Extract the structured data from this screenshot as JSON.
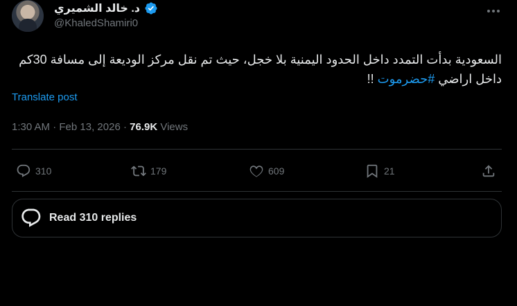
{
  "tweet": {
    "author_name": "د. خالد الشميري",
    "author_handle": "@KhaledShamiri0",
    "text_before_hashtag": "السعودية بدأت التمدد داخل الحدود اليمنية بلا خجل، حيث تم نقل مركز الوديعة إلى مسافة 30كم داخل اراضي ",
    "hashtag": "#حضرموت",
    "text_after_hashtag": " !!",
    "translate_label": "Translate post",
    "time": "1:30 AM",
    "date": "Feb 13, 2026",
    "views_count": "76.9K",
    "views_label": "Views",
    "meta_separator": "·"
  },
  "actions": {
    "replies": "310",
    "reposts": "179",
    "likes": "609",
    "bookmarks": "21"
  },
  "read_replies": {
    "label": "Read 310 replies"
  },
  "icons": [
    "verified-badge-icon",
    "more-icon",
    "reply-icon",
    "repost-icon",
    "like-icon",
    "bookmark-icon",
    "share-icon",
    "read-replies-icon"
  ],
  "colors": {
    "background": "#000000",
    "text": "#e7e9ea",
    "muted": "#71767b",
    "accent": "#1d9bf0",
    "border": "#2f3336"
  }
}
